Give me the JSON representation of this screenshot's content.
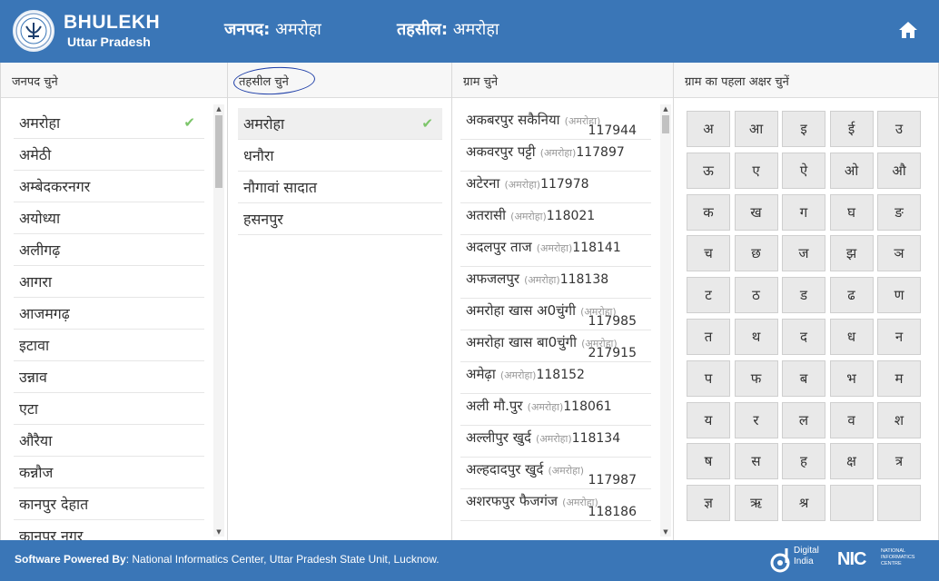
{
  "header": {
    "brand_title": "BHULEKH",
    "brand_sub": "Uttar Pradesh",
    "janpad_label": "जनपद:",
    "janpad_value": "अमरोहा",
    "tehsil_label": "तहसील:",
    "tehsil_value": "अमरोहा",
    "home_icon": "home-icon"
  },
  "janpad_col": {
    "title": "जनपद चुने",
    "items": [
      "अमरोहा",
      "अमेठी",
      "अम्बेदकरनगर",
      "अयोध्या",
      "अलीगढ़",
      "आगरा",
      "आजमगढ़",
      "इटावा",
      "उन्नाव",
      "एटा",
      "औरैया",
      "कन्नौज",
      "कानपुर देहात",
      "कानपुर नगर"
    ],
    "selected": "अमरोहा"
  },
  "tehsil_col": {
    "title": "तहसील चुने",
    "items": [
      "अमरोहा",
      "धनौरा",
      "नौगावां सादात",
      "हसनपुर"
    ],
    "selected": "अमरोहा"
  },
  "gram_col": {
    "title": "ग्राम चुने",
    "items": [
      {
        "name": "अकबरपुर सकैनिया",
        "dist": "(अमरोहा)",
        "code": "117944",
        "wrap": true
      },
      {
        "name": "अकवरपुर पट्टी",
        "dist": "(अमरोहा)",
        "code": "117897",
        "wrap": false
      },
      {
        "name": "अटेरना",
        "dist": "(अमरोहा)",
        "code": "117978",
        "wrap": false
      },
      {
        "name": "अतरासी",
        "dist": "(अमरोहा)",
        "code": "118021",
        "wrap": false
      },
      {
        "name": "अदलपुर ताज",
        "dist": "(अमरोहा)",
        "code": "118141",
        "wrap": false
      },
      {
        "name": "अफजलपुर",
        "dist": "(अमरोहा)",
        "code": "118138",
        "wrap": false
      },
      {
        "name": "अमरोहा खास अ0चुंगी",
        "dist": "(अमरोहा)",
        "code": "117985",
        "wrap": true
      },
      {
        "name": "अमरोहा खास बा0चुंगी",
        "dist": "(अमरोहा)",
        "code": "217915",
        "wrap": true
      },
      {
        "name": "अमेढ़ा",
        "dist": "(अमरोहा)",
        "code": "118152",
        "wrap": false
      },
      {
        "name": "अली मौ.पुर",
        "dist": "(अमरोहा)",
        "code": "118061",
        "wrap": false
      },
      {
        "name": "अल्लीपुर खुर्द",
        "dist": "(अमरोहा)",
        "code": "118134",
        "wrap": false
      },
      {
        "name": "अल्हदादपुर खुर्द",
        "dist": "(अमरोहा)",
        "code": "117987",
        "wrap": true
      },
      {
        "name": "अशरफपुर फैजगंज",
        "dist": "(अमरोहा)",
        "code": "118186",
        "wrap": true
      }
    ]
  },
  "letters_col": {
    "title": "ग्राम का पहला अक्षर चुनें",
    "keys": [
      "अ",
      "आ",
      "इ",
      "ई",
      "उ",
      "ऊ",
      "ए",
      "ऐ",
      "ओ",
      "औ",
      "क",
      "ख",
      "ग",
      "घ",
      "ङ",
      "च",
      "छ",
      "ज",
      "झ",
      "ञ",
      "ट",
      "ठ",
      "ड",
      "ढ",
      "ण",
      "त",
      "थ",
      "द",
      "ध",
      "न",
      "प",
      "फ",
      "ब",
      "भ",
      "म",
      "य",
      "र",
      "ल",
      "व",
      "श",
      "ष",
      "स",
      "ह",
      "क्ष",
      "त्र",
      "ज्ञ",
      "ऋ",
      "श्र",
      "",
      ""
    ]
  },
  "footer": {
    "powered_label": "Software Powered By",
    "powered_text": ": National Informatics Center, Uttar Pradesh State Unit, Lucknow.",
    "di_line1": "Digital",
    "di_line2": "India",
    "nic": "NIC",
    "nic_sub1": "NATIONAL",
    "nic_sub2": "INFORMATICS",
    "nic_sub3": "CENTRE"
  },
  "colors": {
    "header_bg": "#3a76b7",
    "check": "#7cc56a"
  }
}
